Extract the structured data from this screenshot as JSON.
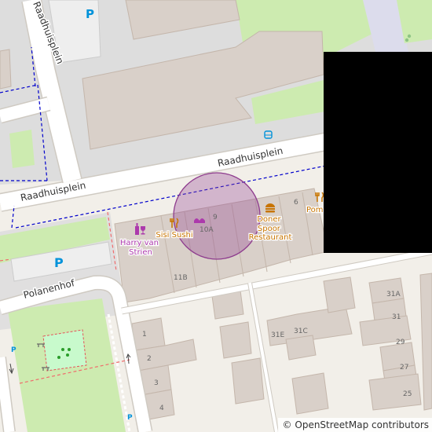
{
  "streets": {
    "raadhuisplein_vertical": "Raadhuisplein",
    "raadhuisplein_main": "Raadhuisplein",
    "raadhuisplein_left": "Raadhuisplein",
    "polanenhof": "Polanenhof"
  },
  "parking": {
    "top": "P",
    "left": "P",
    "small_a": "P",
    "small_b": "P"
  },
  "pois": {
    "harry_van_strien": [
      "Harry van",
      "Strien"
    ],
    "sisi_sushi": "Sisi Sushi",
    "doner_spoor": [
      "Doner",
      "Spoor",
      "Restaurant"
    ],
    "pom": "Pom"
  },
  "house_numbers": {
    "n9": "9",
    "n10a": "10A",
    "n11b": "11B",
    "n6": "6",
    "n1": "1",
    "n2": "2",
    "n3": "3",
    "n4": "4",
    "n31e": "31E",
    "n31c": "31C",
    "n31a": "31A",
    "n31": "31",
    "n29": "29",
    "n27": "27",
    "n25": "25"
  },
  "colors": {
    "background": "#f2efe9",
    "road": "#ffffff",
    "road_casing": "#cfcac2",
    "building": "#d9d0c9",
    "building_stroke": "#c4b6ab",
    "paved": "#dddddd",
    "grass": "#cdebb0",
    "park": "#c8facc",
    "poi_purple": "#ac39ac",
    "poi_orange": "#c77400",
    "parking_blue": "#0092da",
    "location_circle": "#8e3c8e"
  },
  "attribution": {
    "copy": "©",
    "link": "OpenStreetMap contributors"
  }
}
